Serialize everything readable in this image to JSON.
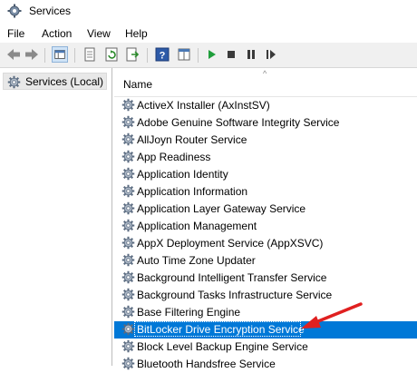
{
  "window": {
    "title": "Services",
    "icon": "gear-icon"
  },
  "menu": [
    "File",
    "Action",
    "View",
    "Help"
  ],
  "toolbar": {
    "buttons": [
      "back-arrow-icon",
      "forward-arrow-icon",
      "show-console-tree-icon",
      "properties-icon",
      "refresh-icon",
      "export-list-icon",
      "help-icon",
      "toggle-view-icon",
      "play-icon",
      "stop-icon",
      "pause-icon",
      "restart-icon"
    ]
  },
  "tree": {
    "item": "Services (Local)"
  },
  "list": {
    "column": "Name",
    "sort_indicator": "^",
    "rows": [
      "ActiveX Installer (AxInstSV)",
      "Adobe Genuine Software Integrity Service",
      "AllJoyn Router Service",
      "App Readiness",
      "Application Identity",
      "Application Information",
      "Application Layer Gateway Service",
      "Application Management",
      "AppX Deployment Service (AppXSVC)",
      "Auto Time Zone Updater",
      "Background Intelligent Transfer Service",
      "Background Tasks Infrastructure Service",
      "Base Filtering Engine",
      "BitLocker Drive Encryption Service",
      "Block Level Backup Engine Service",
      "Bluetooth Handsfree Service"
    ],
    "selected_row": "BitLocker Drive Encryption Service"
  },
  "colors": {
    "selection": "#0078d7",
    "annotation_arrow": "#e02020",
    "play": "#1f9e3b"
  },
  "annotation": "red-arrow-pointing-at-selected-row"
}
